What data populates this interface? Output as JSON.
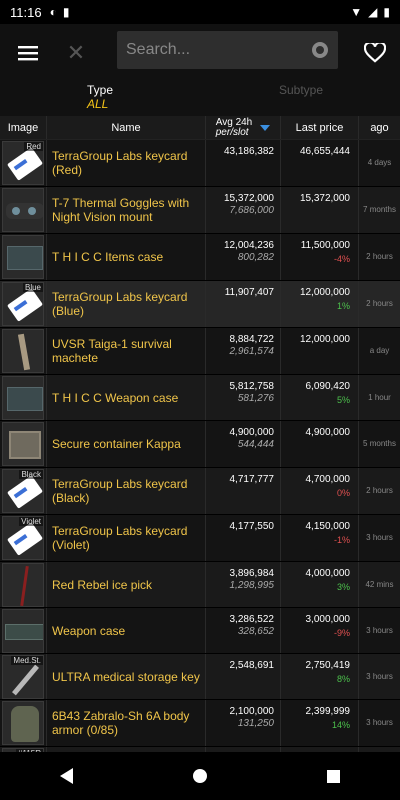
{
  "status_bar": {
    "time": "11:16"
  },
  "search": {
    "placeholder": "Search..."
  },
  "filters": {
    "type_label": "Type",
    "type_value": "ALL",
    "subtype_label": "Subtype"
  },
  "columns": {
    "image": "Image",
    "name": "Name",
    "avg_line1": "Avg 24h",
    "avg_line2": "per/slot",
    "last_price": "Last price",
    "ago": "ago"
  },
  "items": [
    {
      "name": "TerraGroup Labs keycard (Red)",
      "icon": "keycard-red-icon",
      "tag": "Red",
      "avg": "43,186,382",
      "per_slot": "",
      "last": "46,655,444",
      "change": "",
      "ago": "4 days",
      "height": 47
    },
    {
      "name": "T-7 Thermal Goggles with Night Vision mount",
      "icon": "goggles-icon",
      "tag": "",
      "avg": "15,372,000",
      "per_slot": "7,686,000",
      "last": "15,372,000",
      "change": "",
      "ago": "7 months",
      "height": 47
    },
    {
      "name": "T H I C C Items case",
      "icon": "items-case-icon",
      "tag": "",
      "avg": "12,004,236",
      "per_slot": "800,282",
      "last": "11,500,000",
      "change": "-4%",
      "change_sign": "neg",
      "ago": "2 hours",
      "height": 47
    },
    {
      "name": "TerraGroup Labs keycard (Blue)",
      "icon": "keycard-blue-icon",
      "tag": "Blue",
      "avg": "11,907,407",
      "per_slot": "",
      "last": "12,000,000",
      "change": "1%",
      "change_sign": "pos",
      "ago": "2 hours",
      "height": 47,
      "highlight": true
    },
    {
      "name": "UVSR Taiga-1 survival machete",
      "icon": "machete-icon",
      "tag": "",
      "avg": "8,884,722",
      "per_slot": "2,961,574",
      "last": "12,000,000",
      "change": "",
      "ago": "a day",
      "height": 47
    },
    {
      "name": "T H I C C Weapon case",
      "icon": "weapon-case-icon",
      "tag": "",
      "avg": "5,812,758",
      "per_slot": "581,276",
      "last": "6,090,420",
      "change": "5%",
      "change_sign": "pos",
      "ago": "1 hour",
      "height": 46
    },
    {
      "name": "Secure container Kappa",
      "icon": "kappa-container-icon",
      "tag": "",
      "avg": "4,900,000",
      "per_slot": "544,444",
      "last": "4,900,000",
      "change": "",
      "ago": "5 months",
      "height": 47
    },
    {
      "name": "TerraGroup Labs keycard (Black)",
      "icon": "keycard-black-icon",
      "tag": "Black",
      "avg": "4,717,777",
      "per_slot": "",
      "last": "4,700,000",
      "change": "0%",
      "change_sign": "neg",
      "ago": "2 hours",
      "height": 47
    },
    {
      "name": "TerraGroup Labs keycard (Violet)",
      "icon": "keycard-violet-icon",
      "tag": "Violet",
      "avg": "4,177,550",
      "per_slot": "",
      "last": "4,150,000",
      "change": "-1%",
      "change_sign": "neg",
      "ago": "3 hours",
      "height": 47
    },
    {
      "name": "Red Rebel ice pick",
      "icon": "ice-pick-icon",
      "tag": "",
      "avg": "3,896,984",
      "per_slot": "1,298,995",
      "last": "4,000,000",
      "change": "3%",
      "change_sign": "pos",
      "ago": "42 mins",
      "height": 46
    },
    {
      "name": "Weapon case",
      "icon": "weapon-case-small-icon",
      "tag": "",
      "avg": "3,286,522",
      "per_slot": "328,652",
      "last": "3,000,000",
      "change": "-9%",
      "change_sign": "neg",
      "ago": "3 hours",
      "height": 46
    },
    {
      "name": "ULTRA medical storage key",
      "icon": "medical-key-icon",
      "tag": "Med.St.",
      "avg": "2,548,691",
      "per_slot": "",
      "last": "2,750,419",
      "change": "8%",
      "change_sign": "pos",
      "ago": "3 hours",
      "height": 46
    },
    {
      "name": "6B43 Zabralo-Sh 6A body armor (0/85)",
      "icon": "body-armor-icon",
      "tag": "",
      "avg": "2,100,000",
      "per_slot": "131,250",
      "last": "2,399,999",
      "change": "14%",
      "change_sign": "pos",
      "ago": "3 hours",
      "height": 47
    },
    {
      "name": "",
      "icon": "key-icon",
      "tag": "#115R",
      "avg": "",
      "per_slot": "",
      "last": "",
      "change": "",
      "ago": "",
      "height": 47
    }
  ]
}
